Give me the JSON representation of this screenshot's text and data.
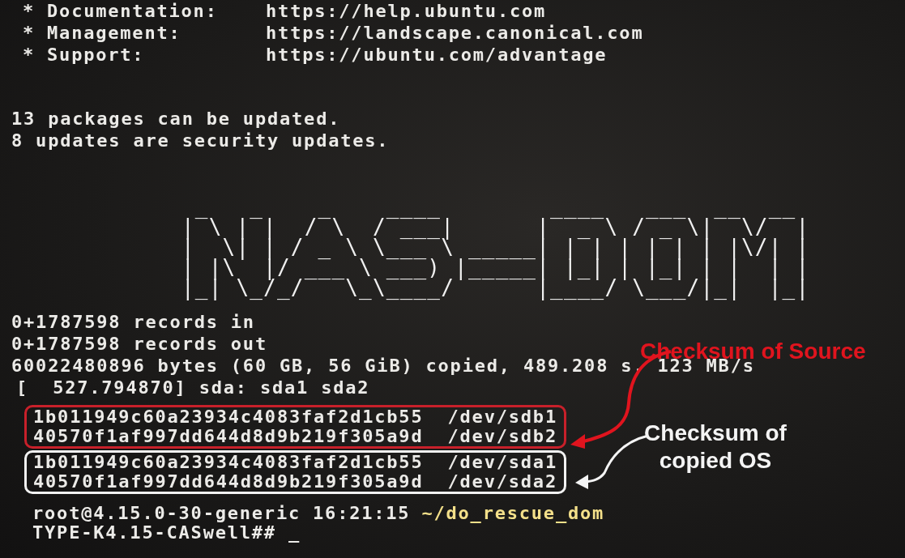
{
  "motd": {
    "links": [
      {
        "bullet": "*",
        "label": "Documentation:",
        "url": "https://help.ubuntu.com"
      },
      {
        "bullet": "*",
        "label": "Management:",
        "url": "https://landscape.canonical.com"
      },
      {
        "bullet": "*",
        "label": "Support:",
        "url": "https://ubuntu.com/advantage"
      }
    ],
    "updates": [
      "13 packages can be updated.",
      "8 updates are security updates."
    ]
  },
  "banner": {
    "lines": [
      " _   _    _    ____        ____   ___  __  __ ",
      "| \\ | |  / \\  / ___|      |  _ \\ / _ \\|  \\/  |",
      "|  \\| | / _ \\ \\___ \\ _____| | | | | | | |\\/| |",
      "| |\\  |/ ___ \\ ___) |_____| |_| | |_| | |  | |",
      "|_| \\_/_/   \\_\\____/      |____/ \\___/|_|  |_|"
    ]
  },
  "output": [
    "0+1787598 records in",
    "0+1787598 records out",
    "60022480896 bytes (60 GB, 56 GiB) copied, 489.208 s, 123 MB/s",
    "[  527.794870] sda: sda1 sda2"
  ],
  "checksum_groups": [
    {
      "color": "#c8202a",
      "lines": [
        "1b011949c60a23934c4083faf2d1cb55  /dev/sdb1",
        "40570f1af997dd644d8d9b219f305a9d  /dev/sdb2"
      ]
    },
    {
      "color": "#f2f2f2",
      "lines": [
        "1b011949c60a23934c4083faf2d1cb55  /dev/sda1",
        "40570f1af997dd644d8d9b219f305a9d  /dev/sda2"
      ]
    }
  ],
  "prompt": {
    "user": "root@4.15.0-30-generic 16:21:15",
    "path": "~/do_rescue_dom",
    "line2": "TYPE-K4.15-CASwell## _"
  },
  "annotations": [
    {
      "text": "Checksum of Source",
      "color": "#e0141e"
    },
    {
      "text": "Checksum of copied OS",
      "color": "#f4f4f4"
    }
  ]
}
